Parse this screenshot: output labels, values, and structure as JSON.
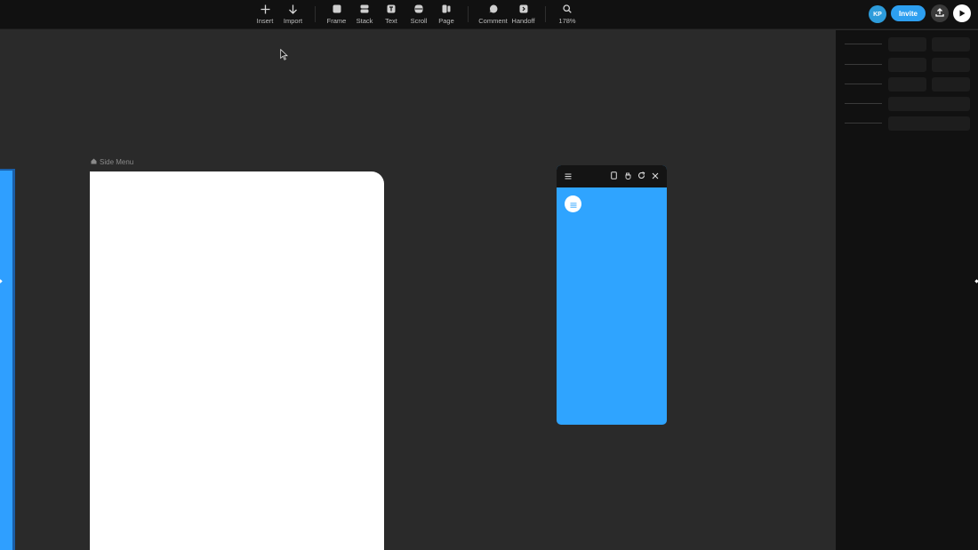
{
  "toolbar": {
    "insert": {
      "label": "Insert",
      "icon": "plus-icon"
    },
    "import": {
      "label": "Import",
      "icon": "arrow-down-icon"
    },
    "frame": {
      "label": "Frame",
      "icon": "frame-icon"
    },
    "stack": {
      "label": "Stack",
      "icon": "stack-icon"
    },
    "text": {
      "label": "Text",
      "icon": "text-icon"
    },
    "scroll": {
      "label": "Scroll",
      "icon": "scroll-icon"
    },
    "page": {
      "label": "Page",
      "icon": "page-icon"
    },
    "comment": {
      "label": "Comment",
      "icon": "comment-icon"
    },
    "handoff": {
      "label": "Handoff",
      "icon": "handoff-icon"
    },
    "zoom": {
      "label": "178%",
      "icon": "search-icon"
    }
  },
  "user": {
    "avatar_initials": "KP",
    "invite_label": "Invite"
  },
  "canvas": {
    "frame_label": "Side Menu"
  },
  "colors": {
    "toolbar_bg": "#111111",
    "canvas_bg": "#2a2a2a",
    "accent": "#2d9ff0",
    "frame_blue": "#2fa4ff"
  }
}
